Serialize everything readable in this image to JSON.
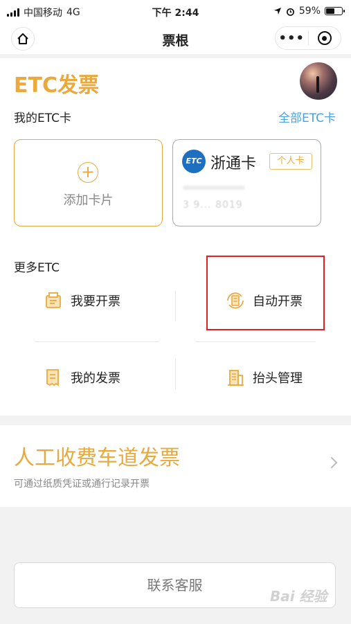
{
  "status_bar": {
    "carrier": "中国移动",
    "network": "4G",
    "time": "下午 2:44",
    "battery_percent": "59%",
    "battery_level": 0.59
  },
  "nav": {
    "title": "票根",
    "home_icon": "home-icon",
    "more_icon": "more-dots-icon",
    "close_icon": "target-icon"
  },
  "etc": {
    "title": "ETC发票",
    "my_cards_label": "我的ETC卡",
    "all_cards_link": "全部ETC卡",
    "add_card_label": "添加卡片",
    "card": {
      "logo_text": "ETC",
      "name": "浙通卡",
      "badge": "个人卡",
      "number_masked": "3 9... 8019"
    },
    "more_label": "更多ETC",
    "actions": [
      {
        "label": "我要开票",
        "icon": "invoice-apply-icon"
      },
      {
        "label": "自动开票",
        "icon": "auto-invoice-icon"
      },
      {
        "label": "我的发票",
        "icon": "my-invoice-icon"
      },
      {
        "label": "抬头管理",
        "icon": "building-icon"
      }
    ]
  },
  "manual": {
    "title": "人工收费车道发票",
    "subtitle": "可通过纸质凭证或通行记录开票"
  },
  "contact_button": "联系客服",
  "watermark": "Bai 经验",
  "colors": {
    "accent": "#e9a93c",
    "link": "#4aa0e0",
    "highlight": "#e02020"
  }
}
